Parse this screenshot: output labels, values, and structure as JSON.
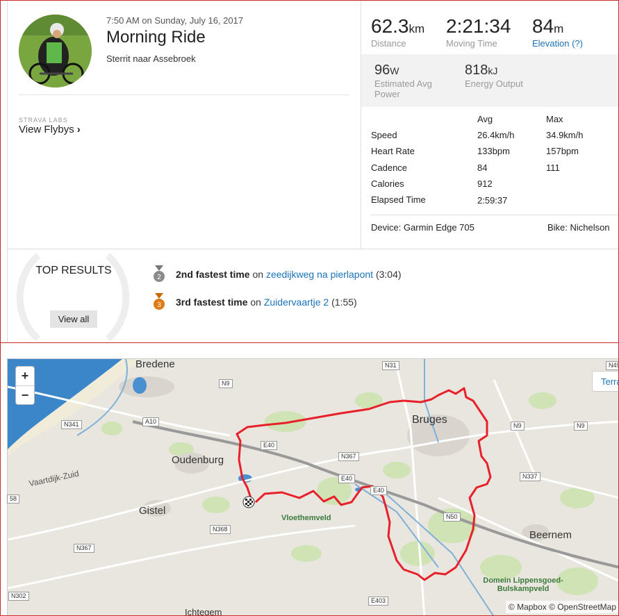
{
  "activity": {
    "datetime": "7:50 AM on Sunday, July 16, 2017",
    "title": "Morning Ride",
    "description": "Sterrit naar Assebroek"
  },
  "labs": {
    "small_label": "STRAVA LABS",
    "link_label": "View Flybys"
  },
  "stats": {
    "distance": {
      "value": "62.3",
      "unit": "km",
      "label": "Distance"
    },
    "moving_time": {
      "value": "2:21:34",
      "label": "Moving Time"
    },
    "elevation": {
      "value": "84",
      "unit": "m",
      "label": "Elevation (?)"
    },
    "power": {
      "value": "96",
      "unit": "W",
      "label": "Estimated Avg Power"
    },
    "energy": {
      "value": "818",
      "unit": "kJ",
      "label": "Energy Output"
    }
  },
  "table": {
    "headers": [
      "Avg",
      "Max"
    ],
    "rows": [
      {
        "label": "Speed",
        "avg": "26.4km/h",
        "max": "34.9km/h"
      },
      {
        "label": "Heart Rate",
        "avg": "133bpm",
        "max": "157bpm"
      },
      {
        "label": "Cadence",
        "avg": "84",
        "max": "111"
      },
      {
        "label": "Calories",
        "avg": "912",
        "max": ""
      },
      {
        "label": "Elapsed Time",
        "avg": "2:59:37",
        "max": ""
      }
    ]
  },
  "device": "Device: Garmin Edge 705",
  "bike": "Bike: Nichelson",
  "top_results": {
    "title": "TOP RESULTS",
    "button": "View all",
    "items": [
      {
        "rank": "2",
        "rank_text": "2nd fastest time",
        "on": "on",
        "segment": "zeedijkweg na pierlapont",
        "time": "(3:04)",
        "color": "#8a8a8a"
      },
      {
        "rank": "3",
        "rank_text": "3rd fastest time",
        "on": "on",
        "segment": "Zuidervaartje 2",
        "time": "(1:55)",
        "color": "#e07b12"
      }
    ]
  },
  "map": {
    "zoom_in": "+",
    "zoom_out": "−",
    "terrain_label": "Terra",
    "attribution": "© Mapbox © OpenStreetMap",
    "towns": [
      "Bredene",
      "Bruges",
      "Oudenburg",
      "Gistel",
      "Beernem",
      "Ichtegem"
    ],
    "areas": [
      "Vloethemveld",
      "Domein Lippensgoed-\nBulskampveld"
    ],
    "roads": [
      "N31",
      "N9",
      "N341",
      "A10",
      "E40",
      "N367",
      "E40",
      "E40",
      "N368",
      "N367",
      "N50",
      "N337",
      "N9",
      "N9",
      "N302",
      "E403",
      "58",
      "N49"
    ],
    "other_labels": [
      "Vaartdijk-Zuid"
    ],
    "route_color": "#e8202a",
    "water_color": "#2f7fc6"
  }
}
